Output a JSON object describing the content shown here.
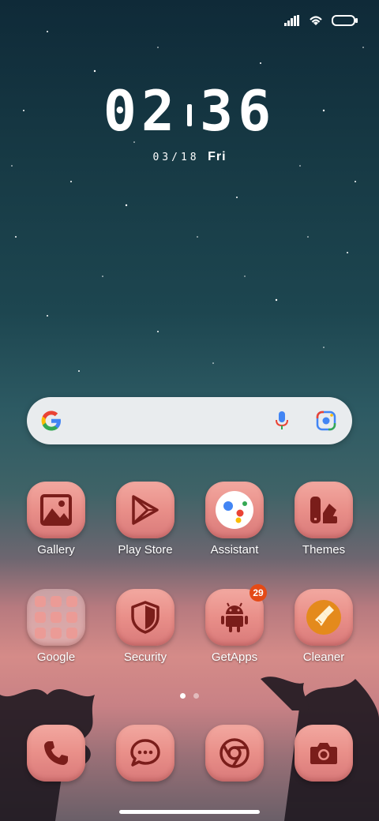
{
  "clock": {
    "hours": "02",
    "minutes": "36",
    "date": "03/18",
    "day": "Fri"
  },
  "apps": [
    {
      "label": "Gallery"
    },
    {
      "label": "Play Store"
    },
    {
      "label": "Assistant"
    },
    {
      "label": "Themes"
    },
    {
      "label": "Google"
    },
    {
      "label": "Security"
    },
    {
      "label": "GetApps",
      "badge": "29"
    },
    {
      "label": "Cleaner"
    }
  ],
  "dock": [
    "phone-icon",
    "messages-icon",
    "chrome-icon",
    "camera-icon"
  ],
  "pages": {
    "count": 2,
    "current": 1
  },
  "colors": {
    "icon_fg": "#7a1d1a",
    "tile": "#e98f89",
    "badge": "#e44a16"
  }
}
